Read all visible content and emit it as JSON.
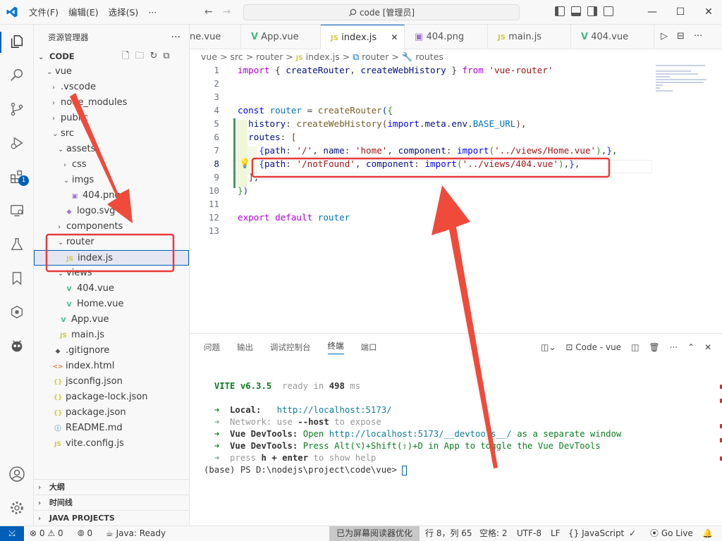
{
  "titlebar": {
    "menu": [
      "文件(F)",
      "编辑(E)",
      "选择(S)",
      "···"
    ],
    "back": "←",
    "forward": "→",
    "search": "code [管理员]",
    "min": "—",
    "max": "☐",
    "close": "✕"
  },
  "activity": {
    "badge": "1"
  },
  "sidebar": {
    "title": "资源管理器",
    "more": "···",
    "root": "CODE",
    "tree": [
      {
        "label": "vue",
        "kind": "folder",
        "open": true,
        "depth": 0
      },
      {
        "label": ".vscode",
        "kind": "folder",
        "open": false,
        "depth": 1
      },
      {
        "label": "node_modules",
        "kind": "folder",
        "open": false,
        "depth": 1
      },
      {
        "label": "public",
        "kind": "folder",
        "open": false,
        "depth": 1
      },
      {
        "label": "src",
        "kind": "folder",
        "open": true,
        "depth": 1
      },
      {
        "label": "assets",
        "kind": "folder",
        "open": true,
        "depth": 2
      },
      {
        "label": "css",
        "kind": "folder",
        "open": false,
        "depth": 3
      },
      {
        "label": "imgs",
        "kind": "folder",
        "open": true,
        "depth": 3
      },
      {
        "label": "404.png",
        "kind": "img",
        "depth": 4
      },
      {
        "label": "logo.svg",
        "kind": "svg",
        "depth": 3
      },
      {
        "label": "components",
        "kind": "folder",
        "open": false,
        "depth": 2
      },
      {
        "label": "router",
        "kind": "folder",
        "open": true,
        "depth": 2
      },
      {
        "label": "index.js",
        "kind": "js",
        "depth": 3,
        "selected": true
      },
      {
        "label": "views",
        "kind": "folder",
        "open": true,
        "depth": 2
      },
      {
        "label": "404.vue",
        "kind": "vue",
        "depth": 3
      },
      {
        "label": "Home.vue",
        "kind": "vue",
        "depth": 3
      },
      {
        "label": "App.vue",
        "kind": "vue",
        "depth": 2
      },
      {
        "label": "main.js",
        "kind": "js",
        "depth": 2
      },
      {
        "label": ".gitignore",
        "kind": "git",
        "depth": 1
      },
      {
        "label": "index.html",
        "kind": "html",
        "depth": 1
      },
      {
        "label": "jsconfig.json",
        "kind": "json",
        "depth": 1
      },
      {
        "label": "package-lock.json",
        "kind": "json",
        "depth": 1
      },
      {
        "label": "package.json",
        "kind": "json",
        "depth": 1
      },
      {
        "label": "README.md",
        "kind": "md",
        "depth": 1
      },
      {
        "label": "vite.config.js",
        "kind": "js",
        "depth": 1
      }
    ],
    "sections": [
      "大纲",
      "时间线",
      "JAVA PROJECTS"
    ]
  },
  "tabs": [
    {
      "label": "ne.vue",
      "kind": "none"
    },
    {
      "label": "App.vue",
      "kind": "vue"
    },
    {
      "label": "index.js",
      "kind": "js",
      "active": true,
      "close": "✕"
    },
    {
      "label": "404.png",
      "kind": "img"
    },
    {
      "label": "main.js",
      "kind": "js"
    },
    {
      "label": "404.vue",
      "kind": "vue"
    }
  ],
  "tab_actions": [
    "▷",
    "⊟",
    "···"
  ],
  "breadcrumb": [
    "vue",
    ">",
    "src",
    ">",
    "router",
    ">",
    "JS",
    "index.js",
    ">",
    "router",
    ">",
    "routes"
  ],
  "editor": {
    "line_numbers": [
      "1",
      "2",
      "3",
      "4",
      "5",
      "6",
      "7",
      "8",
      "9",
      "10",
      "11",
      "12",
      "13"
    ],
    "current_line": "8"
  },
  "panel": {
    "tabs": [
      "问题",
      "输出",
      "调试控制台",
      "终端",
      "端口"
    ],
    "active_tab": "终端",
    "terminal_name": "Code - vue",
    "actions": [
      "+",
      "▾",
      "⫽",
      "🗑",
      "···",
      "⌃",
      "✕"
    ]
  },
  "terminal": {
    "vite": "VITE v6.3.5",
    "ready": "ready in",
    "ms_value": "498",
    "ms": "ms",
    "local_label": "Local:",
    "local_url": "http://localhost:5173/",
    "network_label": "Network:",
    "network_text": "use",
    "network_host": "--host",
    "network_tail": "to expose",
    "devtools_label": "Vue DevTools:",
    "devtools_open": "Open",
    "devtools_url": "http://localhost:5173/__devtools__/",
    "devtools_tail": "as a separate window",
    "devtools2_label": "Vue DevTools:",
    "devtools2_text": "Press Alt(⌥)+Shift(⇧)+D in App to toggle the Vue DevTools",
    "help": "press",
    "help_key": "h + enter",
    "help_tail": "to show help",
    "prompt": "(base) PS D:\\nodejs\\project\\code\\vue> "
  },
  "status": {
    "errors": "0",
    "warnings": "0",
    "ports": "0",
    "java": "Java: Ready",
    "reader": "已为屏幕阅读器优化",
    "position": "行 8，列 65",
    "spaces": "空格: 2",
    "encoding": "UTF-8",
    "eol": "LF",
    "language": "JavaScript",
    "golive": "Go Live"
  }
}
